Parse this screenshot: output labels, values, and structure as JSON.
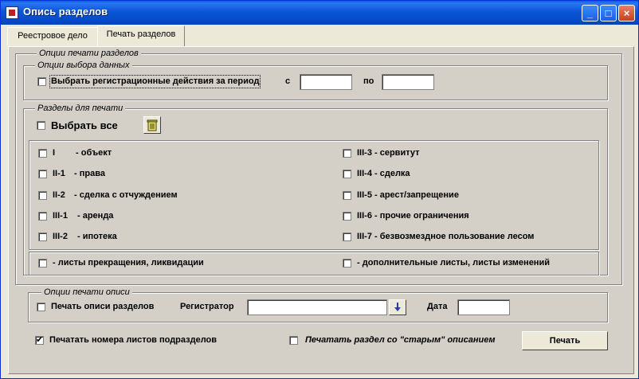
{
  "window": {
    "title": "Опись разделов"
  },
  "tabs": [
    {
      "label": "Реестровое дело",
      "active": false
    },
    {
      "label": "Печать разделов",
      "active": true
    }
  ],
  "print_options": {
    "legend": "Опции печати разделов",
    "data_options": {
      "legend": "Опции выбора данных",
      "period_checkbox_label": "Выбрать регистрационные действия за период",
      "from_label": "с",
      "from_value": "",
      "to_label": "по",
      "to_value": ""
    },
    "sections": {
      "legend": "Разделы для печати",
      "select_all_label": "Выбрать все",
      "left": [
        {
          "code": "I",
          "desc": "- объект"
        },
        {
          "code": "II-1",
          "desc": "- права"
        },
        {
          "code": "II-2",
          "desc": "- сделка с отчуждением"
        },
        {
          "code": "III-1",
          "desc": "- аренда"
        },
        {
          "code": "III-2",
          "desc": "- ипотека"
        }
      ],
      "right": [
        {
          "label": "III-3 - сервитут"
        },
        {
          "label": "III-4 - сделка"
        },
        {
          "label": "III-5 - арест/запрещение"
        },
        {
          "label": "III-6 - прочие ограничения"
        },
        {
          "label": "III-7 - безвозмездное пользование лесом"
        }
      ],
      "extra_left": "- листы прекращения, ликвидации",
      "extra_right": "- дополнительные листы, листы изменений"
    }
  },
  "inventory_options": {
    "legend": "Опции печати описи",
    "print_inventory_label": "Печать описи разделов",
    "registrar_label": "Регистратор",
    "registrar_value": "",
    "date_label": "Дата",
    "date_value": ""
  },
  "footer": {
    "print_sheet_numbers_label": "Печатать номера листов подразделов",
    "print_sheet_numbers_checked": true,
    "old_description_label": "Печатать раздел со \"старым\" описанием",
    "print_button_label": "Печать"
  },
  "colors": {
    "titlebar": "#0b56d8",
    "face": "#d4d0c8"
  },
  "icons": {
    "app": "app-icon",
    "trash": "trash-icon",
    "registrar_button": "dropdown-arrow-icon"
  }
}
